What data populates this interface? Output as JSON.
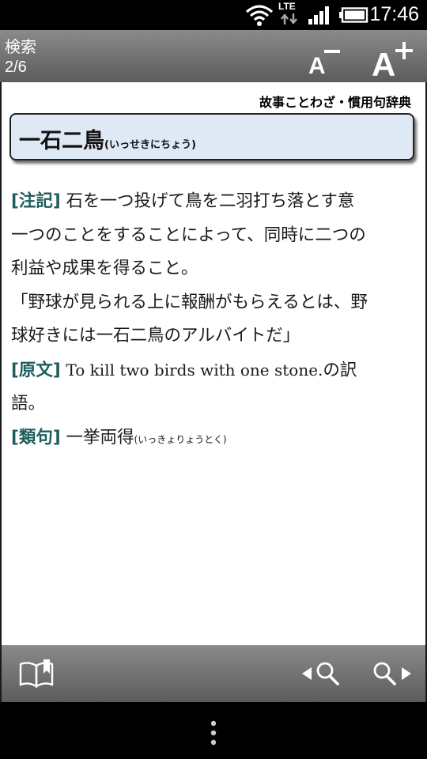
{
  "status_bar": {
    "time": "17:46",
    "network_label": "LTE",
    "icons": [
      "wifi-icon",
      "lte-data-icon",
      "signal-icon",
      "battery-icon"
    ]
  },
  "header": {
    "title": "検索",
    "page_indicator": "2/6",
    "zoom_out_icon": "font-decrease-icon",
    "zoom_in_icon": "font-increase-icon"
  },
  "entry": {
    "dictionary_name": "故事ことわざ・慣用句辞典",
    "headword": "一石二鳥",
    "reading": "(いっせきにちょう)",
    "sections": {
      "note_tag": "[注記]",
      "note_lines": [
        "石を一つ投げて鳥を二羽打ち落とす意",
        "一つのことをすることによって、同時に二つの",
        "利益や成果を得ること。"
      ],
      "example_lines": [
        "「野球が見られる上に報酬がもらえるとは、野",
        "球好きには一石二鳥のアルバイトだ」"
      ],
      "origin_tag": "[原文]",
      "origin_latin": "To kill two birds with one stone.",
      "origin_suffix": "の訳",
      "origin_line2": "語。",
      "synonym_tag": "[類句]",
      "synonym_word": "一挙両得",
      "synonym_reading": "(いっきょりょうとく)"
    }
  },
  "bottom_toolbar": {
    "icons": [
      "book-icon",
      "search-previous-icon",
      "search-next-icon"
    ]
  },
  "colors": {
    "tag_color": "#1e5d5d",
    "headword_bg": "#dfe8f5",
    "bar_top": "#8a8a8a",
    "bar_bottom": "#5c5c5c"
  }
}
